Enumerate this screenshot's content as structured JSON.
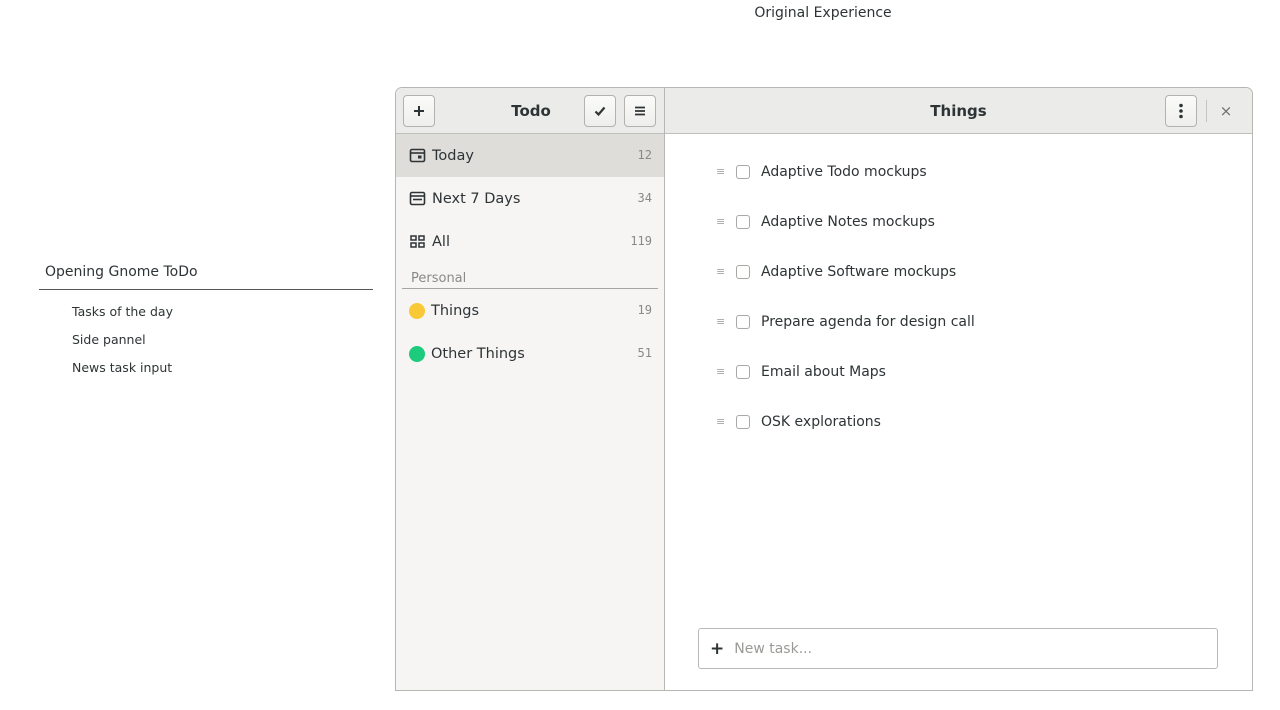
{
  "page": {
    "caption": "Original Experience"
  },
  "outline": {
    "title": "Opening Gnome ToDo",
    "items": [
      "Tasks of the day",
      "Side pannel",
      "News task input"
    ]
  },
  "sidebar": {
    "title": "Todo",
    "add_icon": "plus-icon",
    "check_icon": "checkmark-icon",
    "menu_icon": "hamburger-menu-icon",
    "items": [
      {
        "label": "Today",
        "count": "12",
        "icon": "calendar-today-icon"
      },
      {
        "label": "Next 7 Days",
        "count": "34",
        "icon": "calendar-week-icon"
      },
      {
        "label": "All",
        "count": "119",
        "icon": "grid-icon"
      }
    ],
    "section_label": "Personal",
    "lists": [
      {
        "label": "Things",
        "count": "19",
        "color": "#f8c837"
      },
      {
        "label": "Other Things",
        "count": "51",
        "color": "#1ccb7b"
      }
    ]
  },
  "main": {
    "title": "Things",
    "more_icon": "kebab-menu-icon",
    "close_icon": "close-icon",
    "close_glyph": "×",
    "tasks": [
      "Adaptive Todo mockups",
      "Adaptive Notes mockups",
      "Adaptive Software mockups",
      "Prepare agenda for design call",
      "Email about Maps",
      "OSK explorations"
    ],
    "new_task": {
      "plus": "+",
      "placeholder": "New task..."
    }
  }
}
